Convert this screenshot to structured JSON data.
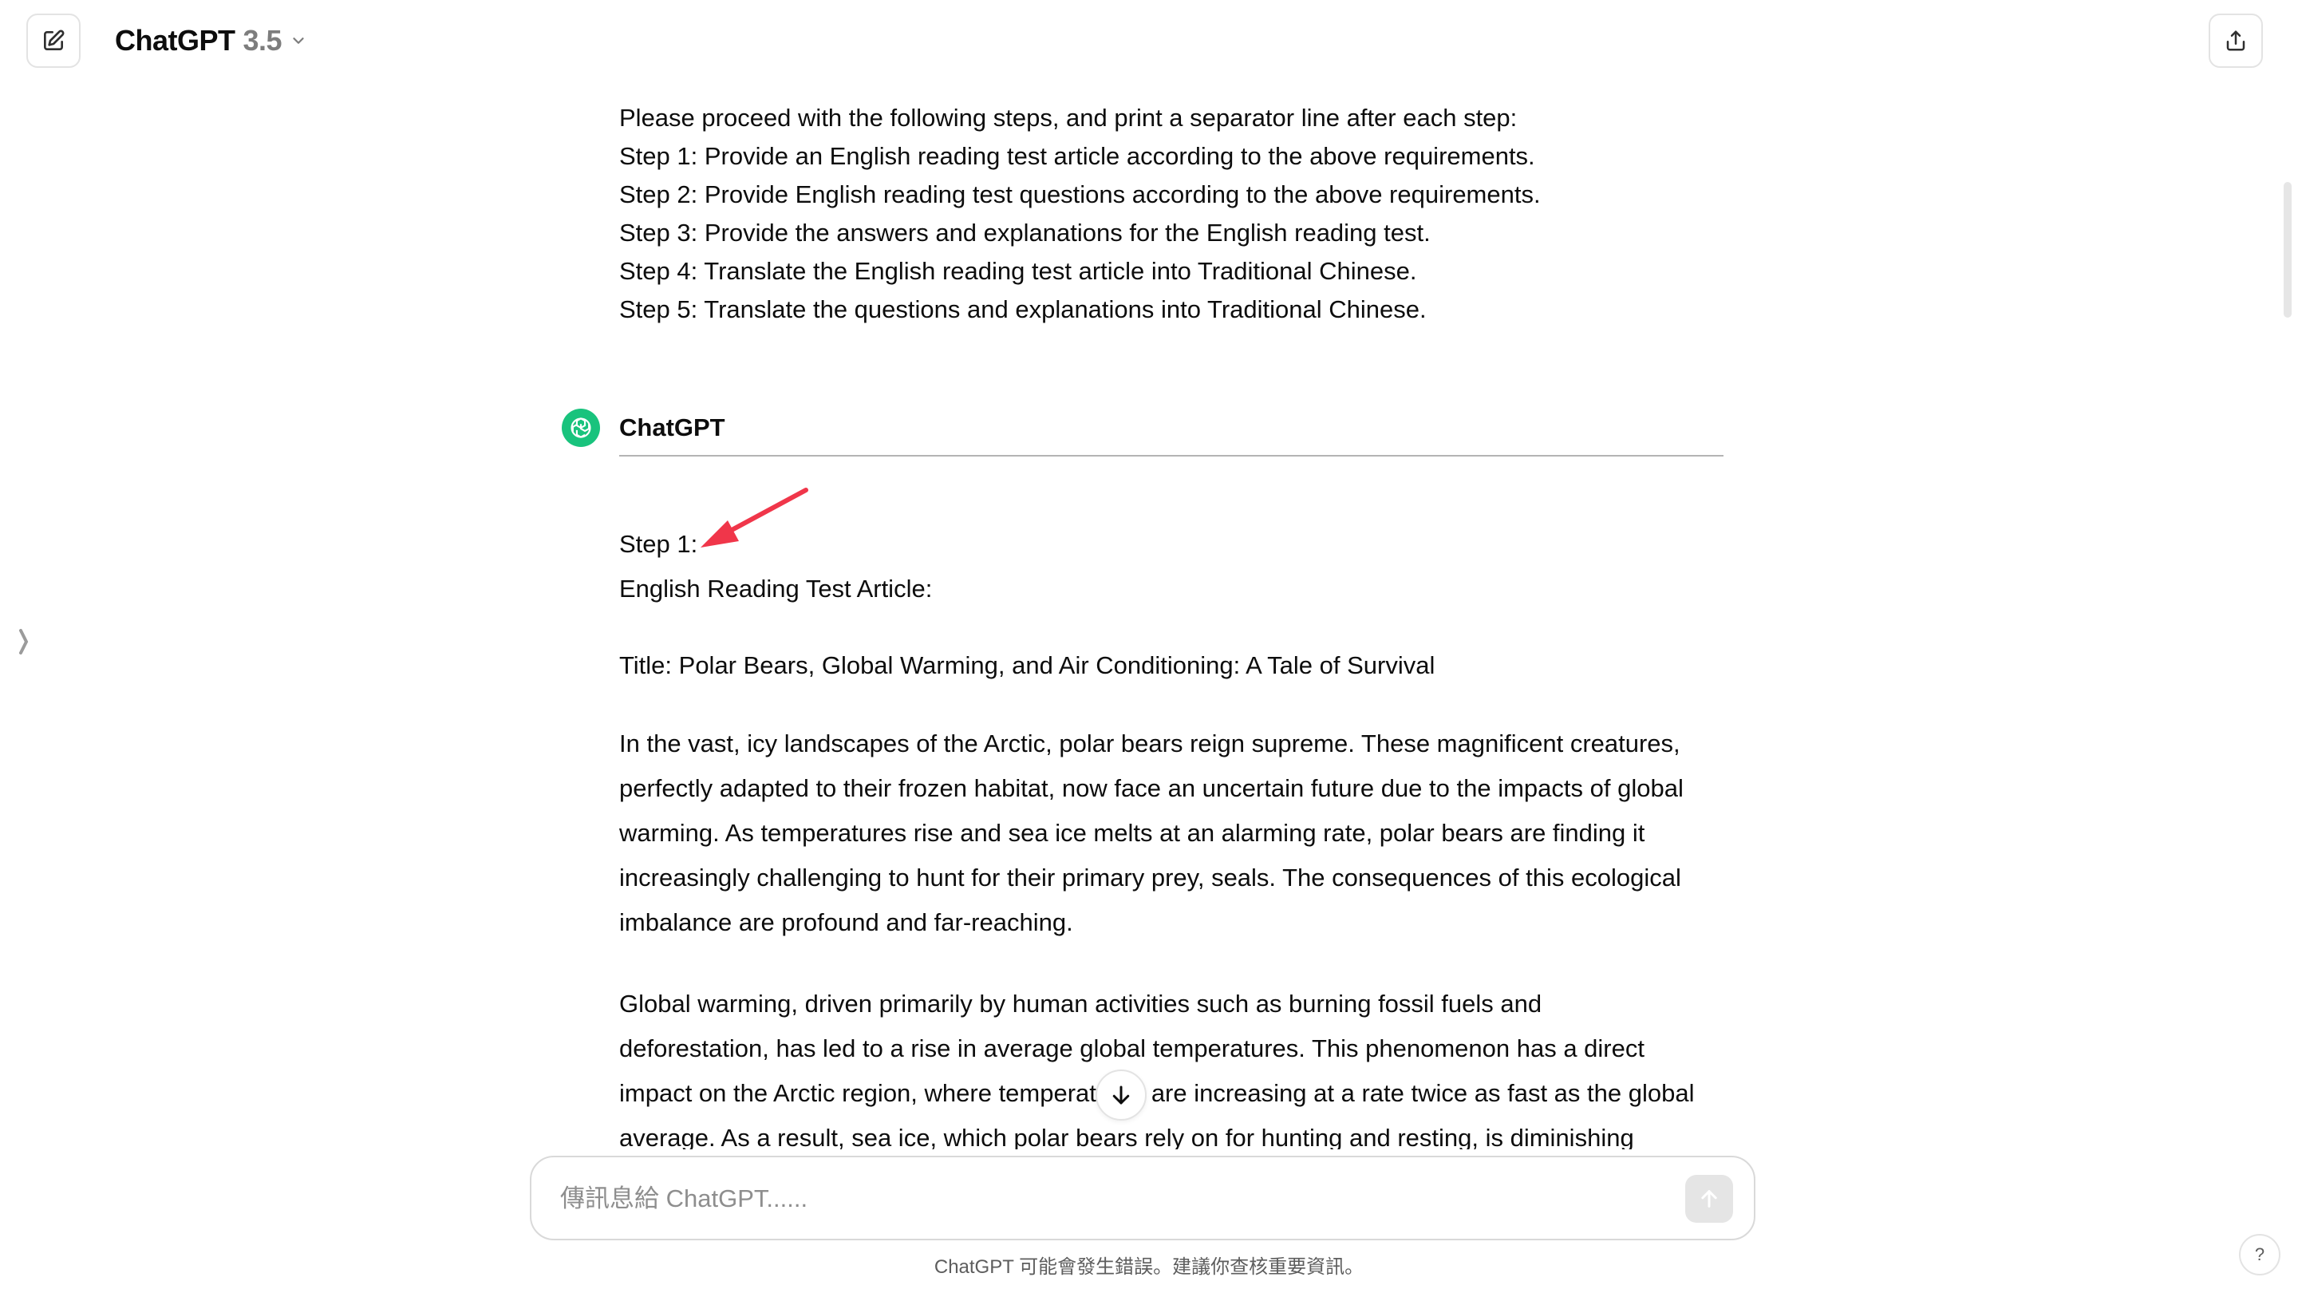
{
  "header": {
    "model_name": "ChatGPT",
    "model_version": "3.5"
  },
  "user_message": {
    "lines": [
      "Please proceed with the following steps, and print a separator line after each step:",
      "Step 1: Provide an English reading test article according to the above requirements.",
      "Step 2: Provide English reading test questions according to the above requirements.",
      "Step 3: Provide the answers and explanations for the English reading test.",
      "Step 4: Translate the English reading test article into Traditional Chinese.",
      "Step 5: Translate the questions and explanations into Traditional Chinese."
    ]
  },
  "assistant": {
    "name": "ChatGPT",
    "step_label": "Step 1:",
    "article_heading": "English Reading Test Article:",
    "title_line": "Title: Polar Bears, Global Warming, and Air Conditioning: A Tale of Survival",
    "paragraphs": [
      [
        "In the vast, icy landscapes of the Arctic, polar bears reign supreme. These magnificent creatures,",
        "perfectly adapted to their frozen habitat, now face an uncertain future due to the impacts of global",
        "warming. As temperatures rise and sea ice melts at an alarming rate, polar bears are finding it",
        "increasingly challenging to hunt for their primary prey, seals. The consequences of this ecological",
        "imbalance are profound and far-reaching."
      ],
      [
        "Global warming, driven primarily by human activities such as burning fossil fuels and",
        "deforestation, has led to a rise in average global temperatures. This phenomenon has a direct",
        "impact on the Arctic region, where temperatures are increasing at a rate twice as fast as the global",
        "average. As a result, sea ice, which polar bears rely on for hunting and resting, is diminishing"
      ]
    ]
  },
  "composer": {
    "placeholder": "傳訊息給 ChatGPT......"
  },
  "footer": {
    "disclaimer": "ChatGPT 可能會發生錯誤。建議你查核重要資訊。",
    "help_label": "?"
  },
  "colors": {
    "accent_avatar": "#19c37d",
    "annotation_arrow": "#f0364a"
  }
}
